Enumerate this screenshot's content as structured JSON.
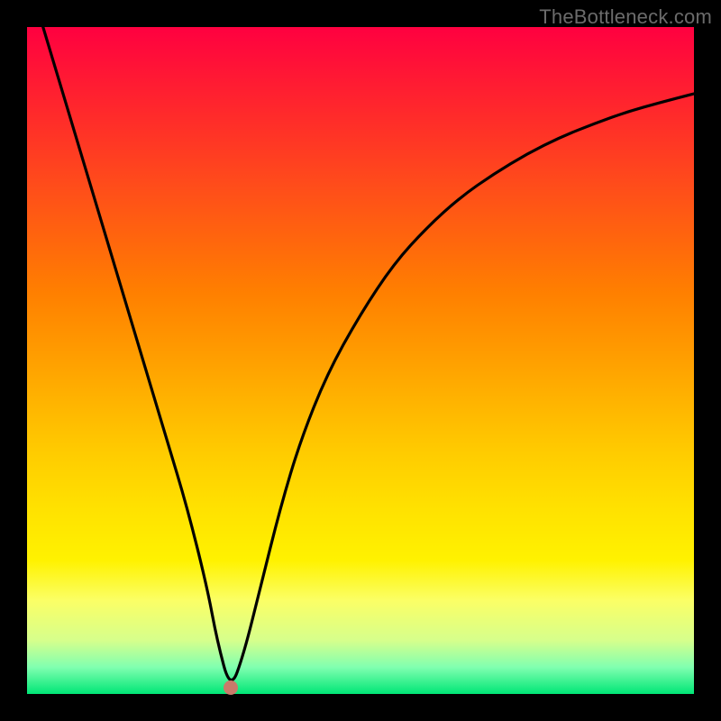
{
  "watermark": "TheBottleneck.com",
  "chart_data": {
    "type": "line",
    "title": "",
    "xlabel": "",
    "ylabel": "",
    "xlim": [
      0,
      100
    ],
    "ylim": [
      0,
      100
    ],
    "grid": false,
    "legend": false,
    "annotation_dot": {
      "x": 30.5,
      "y": 1
    },
    "series": [
      {
        "name": "bottleneck-curve",
        "x": [
          0,
          3,
          6,
          9,
          12,
          15,
          18,
          21,
          24,
          27,
          28.5,
          30.5,
          32.5,
          35,
          38,
          41,
          45,
          50,
          55,
          60,
          65,
          70,
          75,
          80,
          85,
          90,
          95,
          100
        ],
        "values": [
          108,
          98,
          88,
          78,
          68,
          58,
          48,
          38,
          28,
          16,
          8,
          0.5,
          6,
          16,
          28,
          38,
          48,
          57,
          64.5,
          70,
          74.5,
          78,
          81,
          83.5,
          85.5,
          87.3,
          88.7,
          90
        ]
      }
    ],
    "background_gradient": {
      "top": "#ff0040",
      "mid1": "#ff8000",
      "mid2": "#ffe100",
      "bottom": "#00e676"
    }
  }
}
